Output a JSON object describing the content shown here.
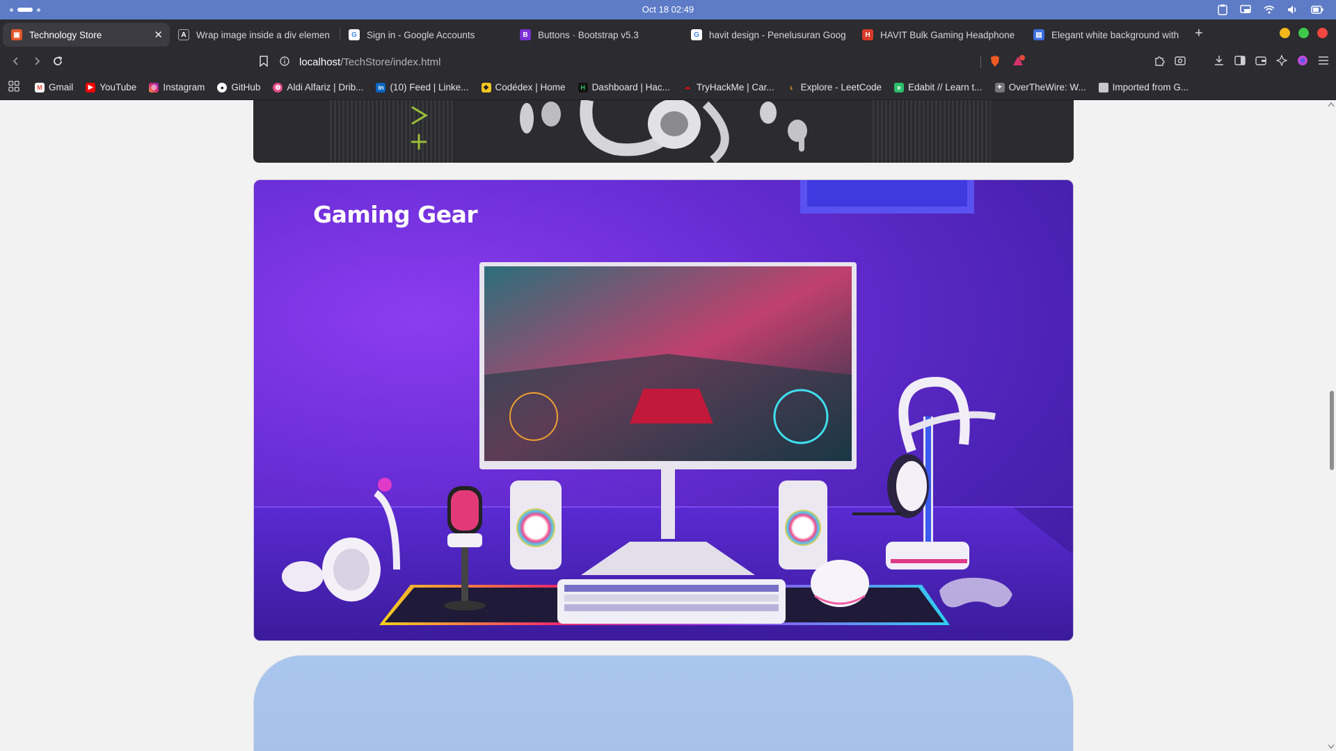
{
  "os": {
    "clock": "Oct 18  02:49"
  },
  "tabs": [
    {
      "title": "Technology Store",
      "icon": "store-favicon",
      "active": true
    },
    {
      "title": "Wrap image inside a div elemen",
      "icon": "ai-favicon",
      "active": false
    },
    {
      "title": "Sign in - Google Accounts",
      "icon": "google-favicon",
      "active": false
    },
    {
      "title": "Buttons · Bootstrap v5.3",
      "icon": "bootstrap-favicon",
      "active": false
    },
    {
      "title": "havit design - Penelusuran Goog",
      "icon": "google-favicon",
      "active": false
    },
    {
      "title": "HAVIT Bulk Gaming Headphone",
      "icon": "havit-favicon",
      "active": false
    },
    {
      "title": "Elegant white background with",
      "icon": "doc-favicon",
      "active": false
    }
  ],
  "address": {
    "host": "localhost",
    "path": "/TechStore/index.html"
  },
  "bookmarks": [
    {
      "label": "Gmail",
      "icon": "gmail-icon"
    },
    {
      "label": "YouTube",
      "icon": "youtube-icon"
    },
    {
      "label": "Instagram",
      "icon": "instagram-icon"
    },
    {
      "label": "GitHub",
      "icon": "github-icon"
    },
    {
      "label": "Aldi Alfariz | Drib...",
      "icon": "dribbble-icon"
    },
    {
      "label": "(10) Feed | Linke...",
      "icon": "linkedin-icon"
    },
    {
      "label": "Codédex | Home",
      "icon": "codedex-icon"
    },
    {
      "label": "Dashboard | Hac...",
      "icon": "hackerrank-icon"
    },
    {
      "label": "TryHackMe | Car...",
      "icon": "tryhackme-icon"
    },
    {
      "label": "Explore - LeetCode",
      "icon": "leetcode-icon"
    },
    {
      "label": "Edabit // Learn t...",
      "icon": "edabit-icon"
    },
    {
      "label": "OverTheWire: W...",
      "icon": "overthewire-icon"
    },
    {
      "label": "Imported from G...",
      "icon": "folder-icon"
    }
  ],
  "page": {
    "gaming_title": "Gaming Gear"
  },
  "colors": {
    "os_bar": "#5d7bc6",
    "browser_chrome": "#2b2b30",
    "gaming_bg": "#6a2ed6",
    "blue_card": "#a9c6ee"
  }
}
